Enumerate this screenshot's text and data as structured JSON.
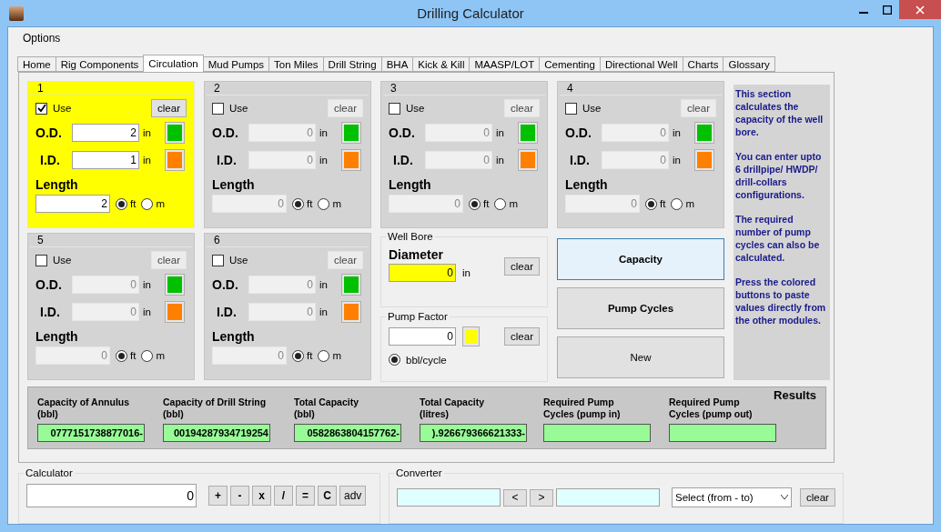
{
  "window": {
    "title": "Drilling Calculator"
  },
  "menu": [
    "Options"
  ],
  "tabs": [
    {
      "label": "Home",
      "selected": false
    },
    {
      "label": "Rig Components",
      "selected": false
    },
    {
      "label": "Circulation",
      "selected": true
    },
    {
      "label": "Mud Pumps",
      "selected": false
    },
    {
      "label": "Ton Miles",
      "selected": false
    },
    {
      "label": "Drill String",
      "selected": false
    },
    {
      "label": "BHA",
      "selected": false
    },
    {
      "label": "Kick & Kill",
      "selected": false
    },
    {
      "label": "MAASP/LOT",
      "selected": false
    },
    {
      "label": "Cementing",
      "selected": false
    },
    {
      "label": "Directional Well",
      "selected": false
    },
    {
      "label": "Charts",
      "selected": false
    },
    {
      "label": "Glossary",
      "selected": false
    }
  ],
  "pipes": [
    {
      "number": "1",
      "use_label": "Use",
      "checked": true,
      "clear": "clear",
      "od_label": "O.D.",
      "od": "2",
      "od_unit": "in",
      "id_label": "I.D.",
      "id": "1",
      "id_unit": "in",
      "length_label": "Length",
      "length": "2",
      "units": [
        {
          "label": "ft",
          "selected": true
        },
        {
          "label": "m",
          "selected": false
        }
      ]
    },
    {
      "number": "2",
      "use_label": "Use",
      "checked": false,
      "clear": "clear",
      "od_label": "O.D.",
      "od": "0",
      "od_unit": "in",
      "id_label": "I.D.",
      "id": "0",
      "id_unit": "in",
      "length_label": "Length",
      "length": "0",
      "units": [
        {
          "label": "ft",
          "selected": true
        },
        {
          "label": "m",
          "selected": false
        }
      ]
    },
    {
      "number": "3",
      "use_label": "Use",
      "checked": false,
      "clear": "clear",
      "od_label": "O.D.",
      "od": "0",
      "od_unit": "in",
      "id_label": "I.D.",
      "id": "0",
      "id_unit": "in",
      "length_label": "Length",
      "length": "0",
      "units": [
        {
          "label": "ft",
          "selected": true
        },
        {
          "label": "m",
          "selected": false
        }
      ]
    },
    {
      "number": "4",
      "use_label": "Use",
      "checked": false,
      "clear": "clear",
      "od_label": "O.D.",
      "od": "0",
      "od_unit": "in",
      "id_label": "I.D.",
      "id": "0",
      "id_unit": "in",
      "length_label": "Length",
      "length": "0",
      "units": [
        {
          "label": "ft",
          "selected": true
        },
        {
          "label": "m",
          "selected": false
        }
      ]
    },
    {
      "number": "5",
      "use_label": "Use",
      "checked": false,
      "clear": "clear",
      "od_label": "O.D.",
      "od": "0",
      "od_unit": "in",
      "id_label": "I.D.",
      "id": "0",
      "id_unit": "in",
      "length_label": "Length",
      "length": "0",
      "units": [
        {
          "label": "ft",
          "selected": true
        },
        {
          "label": "m",
          "selected": false
        }
      ]
    },
    {
      "number": "6",
      "use_label": "Use",
      "checked": false,
      "clear": "clear",
      "od_label": "O.D.",
      "od": "0",
      "od_unit": "in",
      "id_label": "I.D.",
      "id": "0",
      "id_unit": "in",
      "length_label": "Length",
      "length": "0",
      "units": [
        {
          "label": "ft",
          "selected": true
        },
        {
          "label": "m",
          "selected": false
        }
      ]
    }
  ],
  "info": [
    "This section calculates the capacity of the well bore.",
    "You can enter upto 6 drillpipe/ HWDP/ drill-collars configurations.",
    "The required number of pump cycles can also be calculated.",
    "Press the colored buttons to paste values directly from the other modules."
  ],
  "well_bore": {
    "title": "Well Bore",
    "label": "Diameter",
    "value": "0",
    "unit": "in",
    "clear": "clear"
  },
  "pump_factor": {
    "title": "Pump Factor",
    "value": "0",
    "clear": "clear",
    "units": [
      {
        "label": "bbl/cycle",
        "selected": true
      }
    ]
  },
  "actions": [
    {
      "label": "Capacity",
      "selected": true,
      "bold": true
    },
    {
      "label": "Pump Cycles",
      "selected": false,
      "bold": true
    },
    {
      "label": "New",
      "selected": false,
      "bold": false
    }
  ],
  "results": {
    "title": "Results",
    "columns": [
      {
        "label": "Capacity of Annulus\n(bbl)",
        "value": "0777151738877016-"
      },
      {
        "label": "Capacity of Drill String\n(bbl)",
        "value": "00194287934719254"
      },
      {
        "label": "Total Capacity\n(bbl)",
        "value": "0582863804157762-"
      },
      {
        "label": "Total Capacity\n(litres)",
        "value": ").926679366621333-"
      },
      {
        "label": "Required Pump\nCycles (pump in)"
      },
      {
        "label": "Required Pump\nCycles (pump out)"
      }
    ]
  },
  "calculator": {
    "title": "Calculator",
    "value": "0",
    "keys": [
      "+",
      "-",
      "x",
      "/",
      "=",
      "C",
      "adv"
    ]
  },
  "converter": {
    "title": "Converter",
    "buttons": [
      "<",
      ">"
    ],
    "select": "Select (from - to)",
    "clear": "clear"
  }
}
